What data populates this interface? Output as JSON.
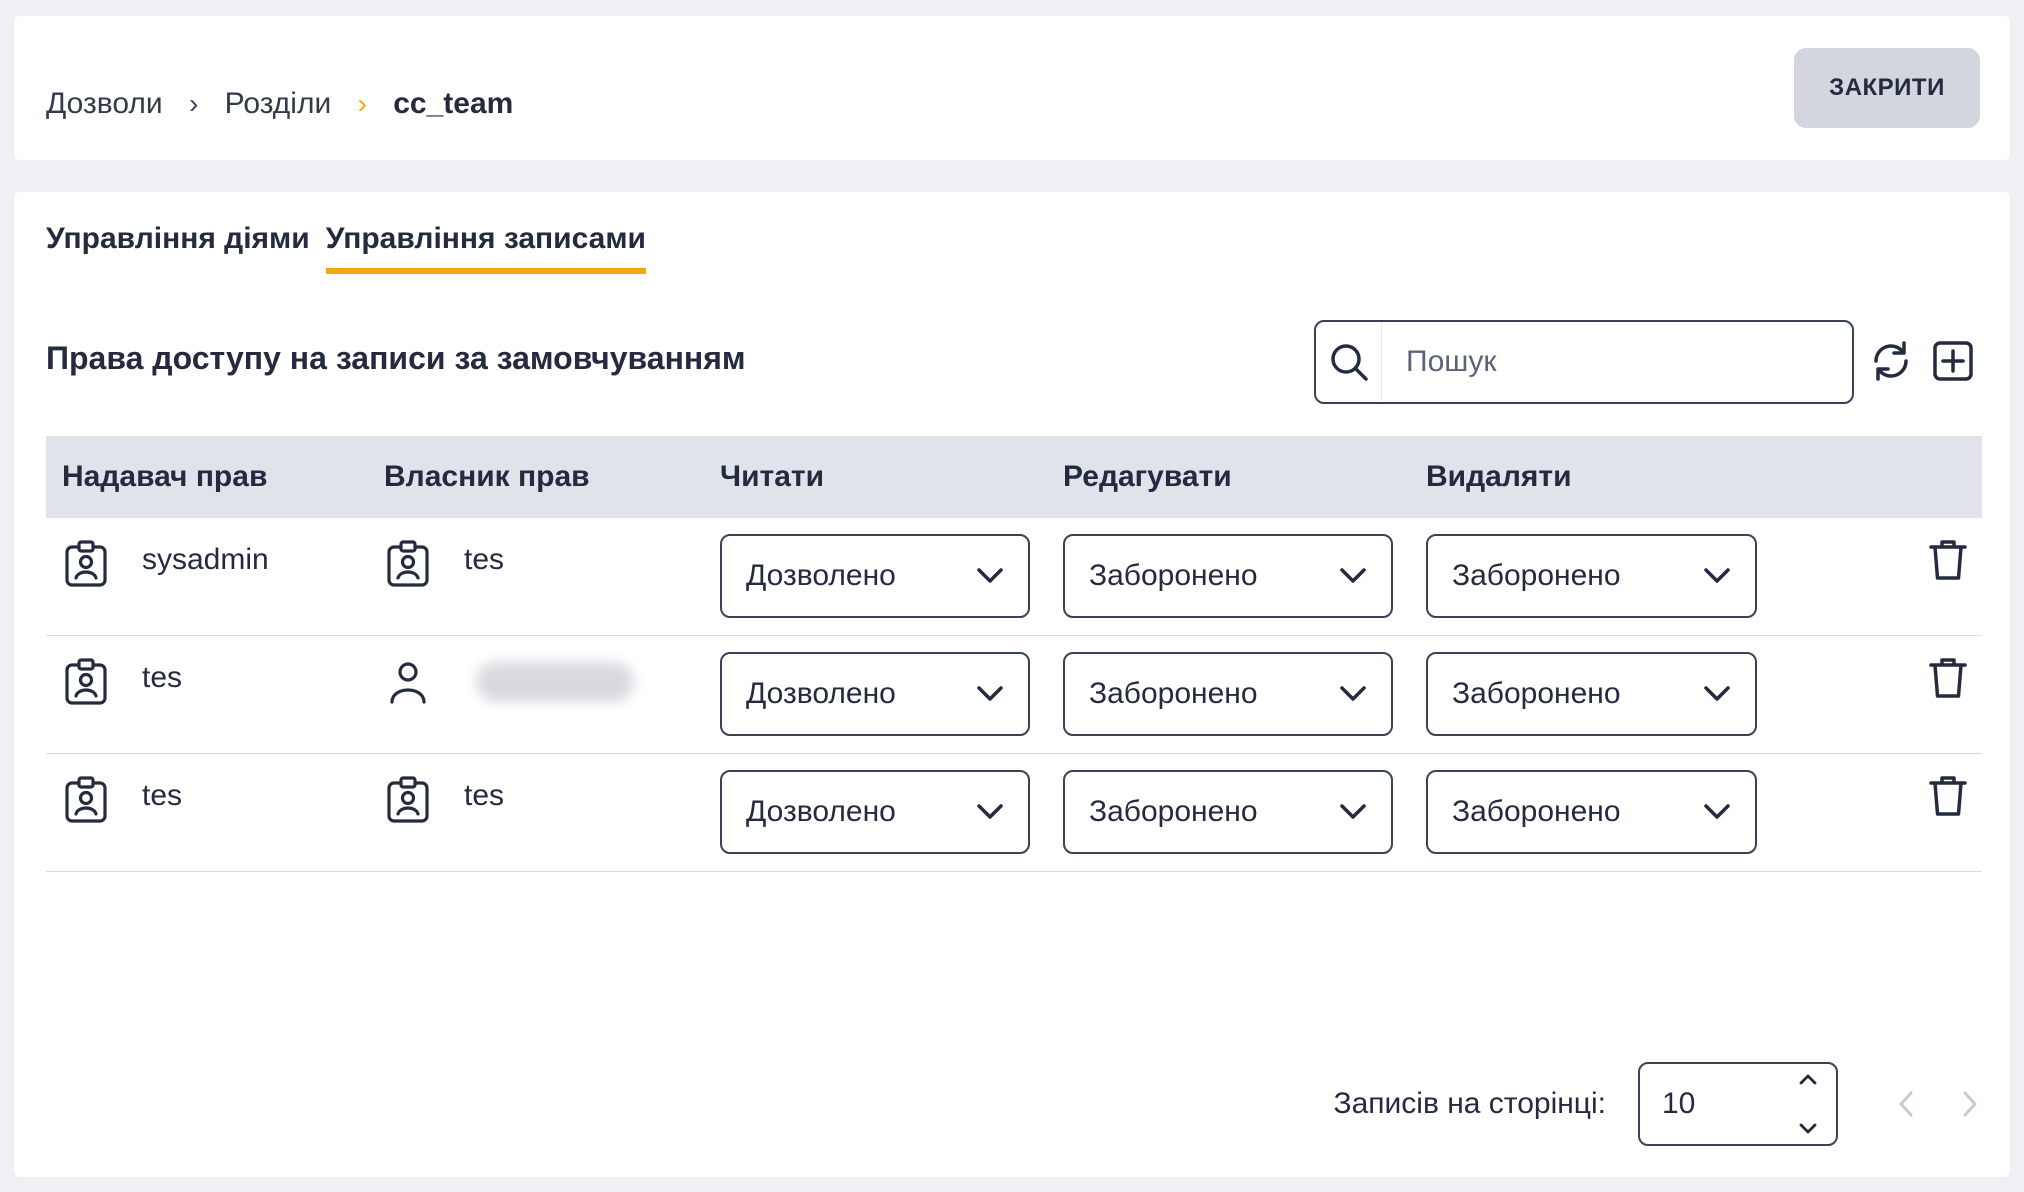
{
  "breadcrumb": {
    "items": [
      "Дозволи",
      "Розділи",
      "cc_team"
    ],
    "separator": "›"
  },
  "header": {
    "close_label": "ЗАКРИТИ"
  },
  "tabs": [
    {
      "label": "Управління діями",
      "active": false
    },
    {
      "label": "Управління записами",
      "active": true
    }
  ],
  "section": {
    "title": "Права доступу на записи за замовчуванням"
  },
  "search": {
    "placeholder": "Пошук",
    "value": ""
  },
  "table": {
    "headers": [
      "Надавач прав",
      "Власник прав",
      "Читати",
      "Редагувати",
      "Видаляти"
    ],
    "rows": [
      {
        "grantor": "sysadmin",
        "grantor_icon": "role-badge-icon",
        "owner": "tes",
        "owner_icon": "role-badge-icon",
        "read": "Дозволено",
        "edit": "Заборонено",
        "delete": "Заборонено"
      },
      {
        "grantor": "tes",
        "grantor_icon": "role-badge-icon",
        "owner": "",
        "owner_icon": "user-icon",
        "read": "Дозволено",
        "edit": "Заборонено",
        "delete": "Заборонено"
      },
      {
        "grantor": "tes",
        "grantor_icon": "role-badge-icon",
        "owner": "tes",
        "owner_icon": "role-badge-icon",
        "read": "Дозволено",
        "edit": "Заборонено",
        "delete": "Заборонено"
      }
    ]
  },
  "pagination": {
    "per_page_label": "Записів на сторінці:",
    "per_page_value": "10"
  },
  "colors": {
    "accent": "#f3a712",
    "text": "#252b3f",
    "header_bg": "#e1e3eb",
    "close_button_bg": "#d3d6df",
    "page_bg": "#eff0f4"
  }
}
